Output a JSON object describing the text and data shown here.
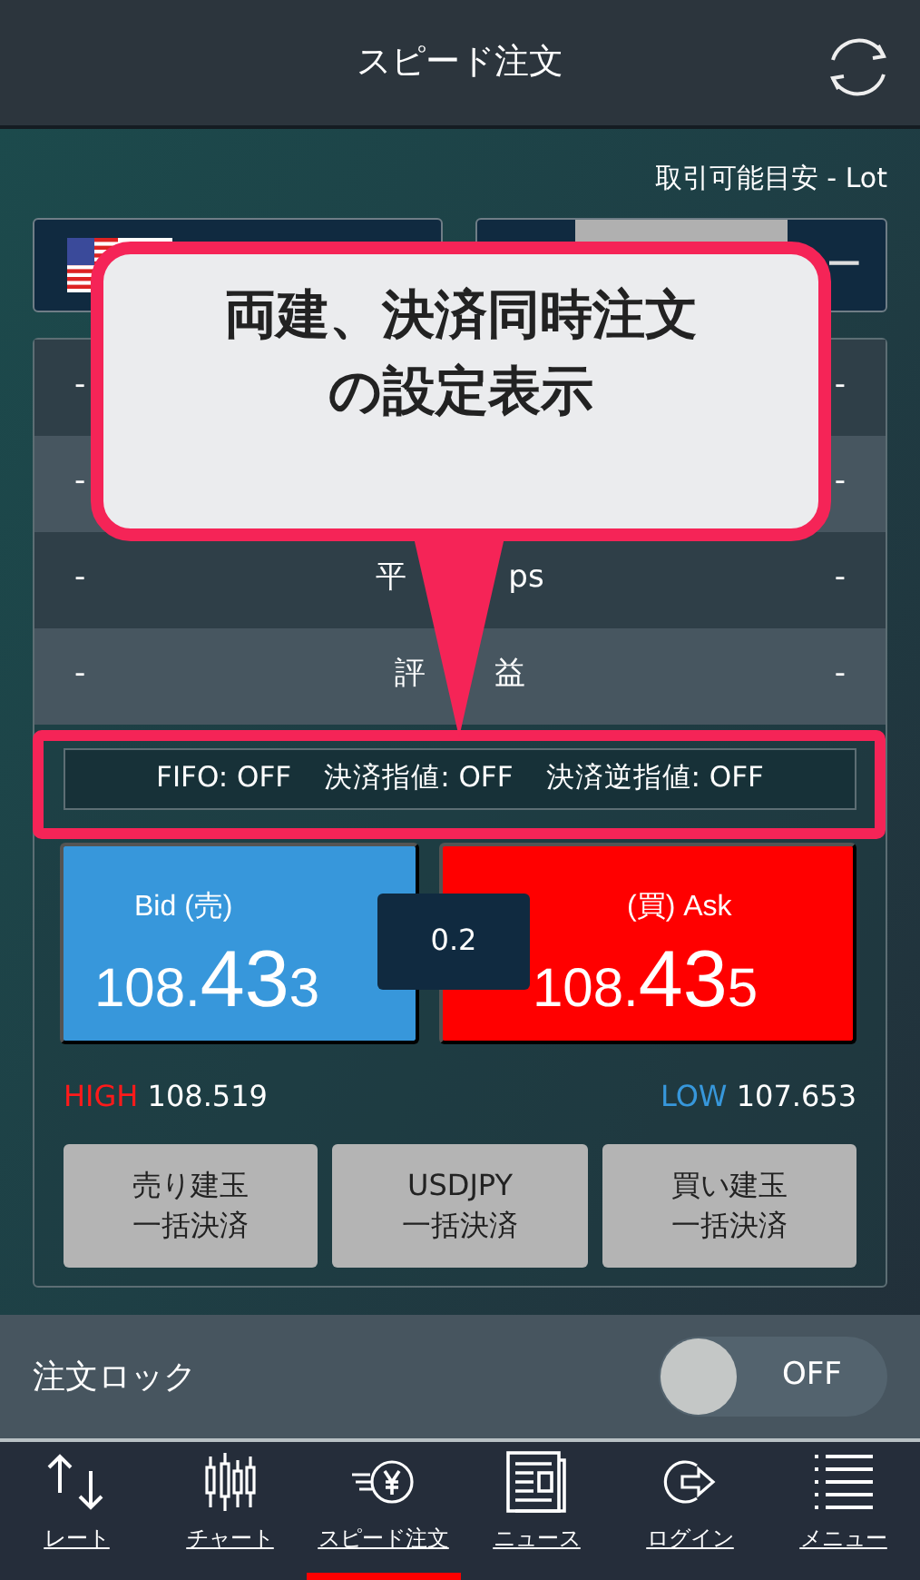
{
  "header": {
    "title": "スピード注文"
  },
  "available": {
    "text": "取引可能目安 - Lot"
  },
  "stepper": {
    "minus": "−"
  },
  "summary_rows": [
    {
      "left": "-",
      "right": "-"
    },
    {
      "left": "-",
      "right": "-"
    },
    {
      "left": "-",
      "label_parts": [
        "平",
        "ps"
      ],
      "right": "-"
    },
    {
      "left": "-",
      "label_parts": [
        "評",
        "益"
      ],
      "right": "-"
    }
  ],
  "settings": [
    "FIFO: OFF",
    "決済指値: OFF",
    "決済逆指値: OFF"
  ],
  "quotes": [
    {
      "kind": "bid",
      "label": "Bid (売)",
      "price_parts": [
        "108.",
        "43",
        "3"
      ]
    },
    {
      "kind": "ask",
      "label": "(買) Ask",
      "price_parts": [
        "108.",
        "43",
        "5"
      ]
    }
  ],
  "spread": "0.2",
  "high": {
    "label": "HIGH",
    "value": "108.519"
  },
  "low": {
    "label": "LOW",
    "value": "107.653"
  },
  "buttons": [
    {
      "lines": [
        "売り建玉",
        "一括決済"
      ]
    },
    {
      "lines": [
        "USDJPY",
        "一括決済"
      ]
    },
    {
      "lines": [
        "買い建玉",
        "一括決済"
      ]
    }
  ],
  "order_lock": {
    "label": "注文ロック",
    "on": false,
    "state_text": "OFF"
  },
  "tabs": [
    {
      "kind": "rate",
      "label": "レート",
      "selected": false
    },
    {
      "kind": "chart",
      "label": "チャート",
      "selected": false
    },
    {
      "kind": "speed",
      "label": "スピード注文",
      "selected": true
    },
    {
      "kind": "news",
      "label": "ニュース",
      "selected": false
    },
    {
      "kind": "login",
      "label": "ログイン",
      "selected": false
    },
    {
      "kind": "menu",
      "label": "メニュー",
      "selected": false
    }
  ],
  "callout": {
    "lines": [
      "両建、決済同時注文",
      "の設定表示"
    ]
  }
}
